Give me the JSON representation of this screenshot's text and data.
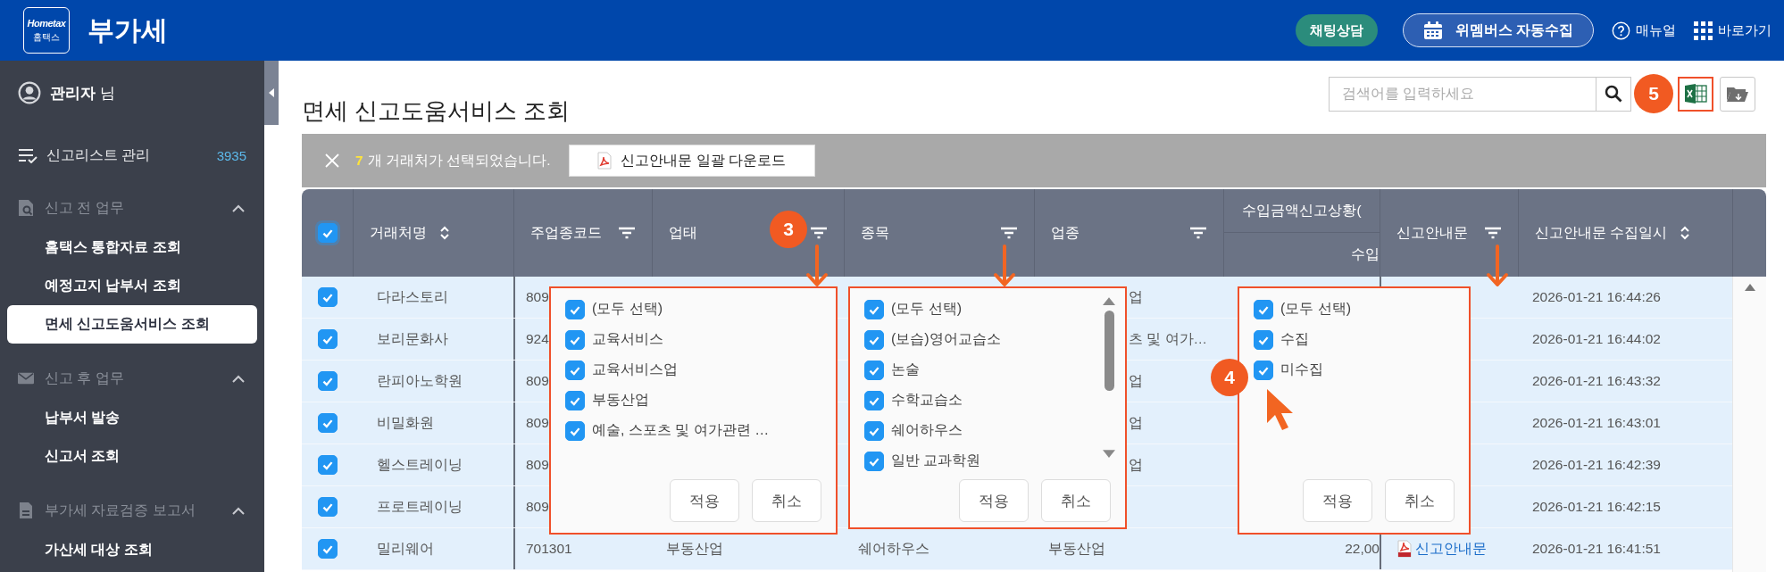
{
  "header": {
    "logo": {
      "text": "Hometax",
      "subtext": "홈택스"
    },
    "title": "부가세",
    "actions": [
      {
        "kind": "chat",
        "label": "채팅상담"
      },
      {
        "kind": "collect",
        "label": "위멤버스 자동수집"
      },
      {
        "kind": "manual",
        "label": "매뉴얼"
      },
      {
        "kind": "shortcut",
        "label": "바로가기"
      }
    ]
  },
  "sidebar": {
    "user": "**관리자** 님",
    "list_manage": {
      "label": "신고리스트 관리",
      "count": "3935"
    },
    "sections": [
      {
        "kind": "search-doc",
        "label": "신고 전 업무",
        "expanded": true,
        "items": [
          {
            "label": "홈택스 통합자료 조회",
            "selected": false
          },
          {
            "label": "예정고지 납부서 조회",
            "selected": false
          },
          {
            "label": "면세 신고도움서비스 조회",
            "selected": true
          }
        ]
      },
      {
        "kind": "mail",
        "label": "신고 후 업무",
        "expanded": true,
        "items": [
          {
            "label": "납부서 발송",
            "selected": false
          },
          {
            "label": "신고서 조회",
            "selected": false
          }
        ]
      },
      {
        "kind": "doc",
        "label": "부가세 자료검증 보고서",
        "expanded": true,
        "items": [
          {
            "label": "가산세 대상 조회",
            "selected": false
          }
        ]
      }
    ]
  },
  "page": {
    "title": "면세 신고도움서비스 조회"
  },
  "toolbar": {
    "search_placeholder": "검색어를 입력하세요",
    "badge": "5",
    "buttons": [
      {
        "kind": "excel",
        "highlighted": true
      },
      {
        "kind": "folder",
        "highlighted": false
      }
    ]
  },
  "selection_bar": {
    "count": "7",
    "message": "개 거래처가 선택되었습니다.",
    "download_label": "신고안내문 일괄 다운로드"
  },
  "table": {
    "all_checked": true,
    "columns": [
      {
        "label": "거래처명",
        "kind": "sort"
      },
      {
        "label": "주업종코드",
        "kind": "filter"
      },
      {
        "label": "업태",
        "kind": "filter"
      },
      {
        "label": "종목",
        "kind": "filter"
      },
      {
        "label": "업종",
        "kind": "filter"
      },
      {
        "label": "수입금액신고상황(",
        "sublabel": "수입",
        "kind": "group"
      },
      {
        "label": "신고안내문",
        "kind": "filter"
      },
      {
        "label": "신고안내문 수집일시",
        "kind": "sort"
      }
    ],
    "rows": [
      {
        "checked": true,
        "name": "다라스토리",
        "code": "809",
        "industry": "업",
        "collected_at": "2026-01-21 16:44:26"
      },
      {
        "checked": true,
        "name": "보리문화사",
        "code": "924",
        "industry": "츠 및 여가…",
        "collected_at": "2026-01-21 16:44:02"
      },
      {
        "checked": true,
        "name": "란피아노학원",
        "code": "809",
        "industry": "업",
        "collected_at": "2026-01-21 16:43:32"
      },
      {
        "checked": true,
        "name": "비밀화원",
        "code": "809",
        "industry": "업",
        "collected_at": "2026-01-21 16:43:01"
      },
      {
        "checked": true,
        "name": "헬스트레이닝",
        "code": "809",
        "industry": "업",
        "collected_at": "2026-01-21 16:42:39"
      },
      {
        "checked": true,
        "name": "프로트레이닝",
        "code": "809",
        "collected_at": "2026-01-21 16:42:15"
      },
      {
        "checked": true,
        "name": "밀리웨어",
        "code": "701301",
        "business": "부동산업",
        "item": "쉐어하우스",
        "industry": "부동산업",
        "income": "22,00",
        "notice": "신고안내문",
        "collected_at": "2026-01-21 16:41:51"
      }
    ]
  },
  "filters": [
    {
      "badge": "3",
      "scrollable": false,
      "cursor": false,
      "items": [
        {
          "label": "(모두 선택)",
          "checked": true
        },
        {
          "label": "교육서비스",
          "checked": true
        },
        {
          "label": "교육서비스업",
          "checked": true
        },
        {
          "label": "부동산업",
          "checked": true
        },
        {
          "label": "예술, 스포츠 및 여가관련 …",
          "checked": true
        }
      ],
      "buttons": [
        "적용",
        "취소"
      ]
    },
    {
      "scrollable": true,
      "cursor": false,
      "items": [
        {
          "label": "(모두 선택)",
          "checked": true
        },
        {
          "label": "(보습)영어교습소",
          "checked": true
        },
        {
          "label": "논술",
          "checked": true
        },
        {
          "label": "수학교습소",
          "checked": true
        },
        {
          "label": "쉐어하우스",
          "checked": true
        },
        {
          "label": "일반 교과학원",
          "checked": true
        }
      ],
      "buttons": [
        "적용",
        "취소"
      ]
    },
    {
      "badge": "4",
      "scrollable": false,
      "cursor": true,
      "items": [
        {
          "label": "(모두 선택)",
          "checked": true
        },
        {
          "label": "수집",
          "checked": true
        },
        {
          "label": "미수집",
          "checked": true
        }
      ],
      "buttons": [
        "적용",
        "취소"
      ]
    }
  ]
}
